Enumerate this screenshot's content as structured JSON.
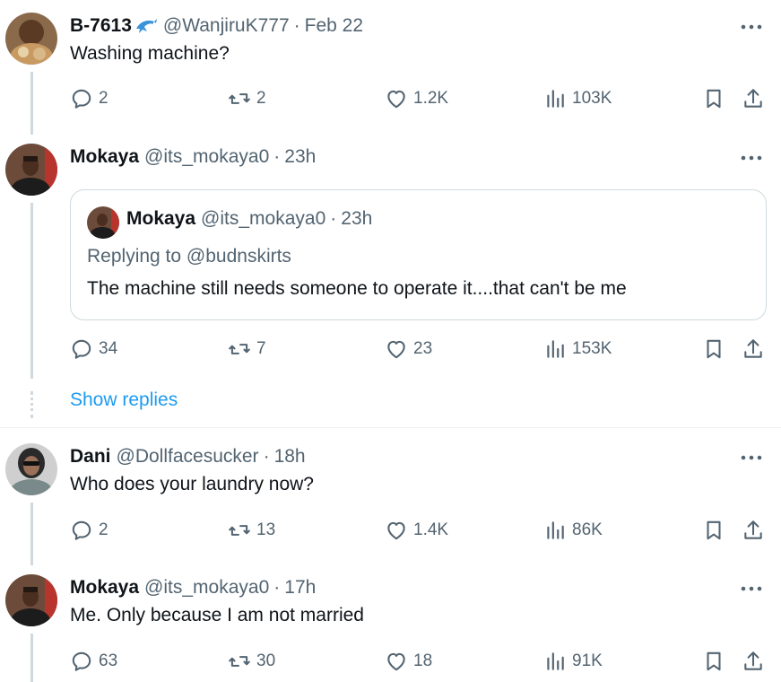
{
  "tweets": [
    {
      "name": "B-7613",
      "handle": "@WanjiruK777",
      "time": "Feb 22",
      "text": "Washing machine?",
      "replies": "2",
      "retweets": "2",
      "likes": "1.2K",
      "views": "103K",
      "emoji": "dolphin-emoji"
    },
    {
      "name": "Mokaya",
      "handle": "@its_mokaya0",
      "time": "23h",
      "quote": {
        "name": "Mokaya",
        "handle": "@its_mokaya0",
        "time": "23h",
        "replying_prefix": "Replying to",
        "replying_to": "@budnskirts",
        "text": "The machine still needs someone to operate it....that can't be me"
      },
      "replies": "34",
      "retweets": "7",
      "likes": "23",
      "views": "153K"
    },
    {
      "name": "Dani",
      "handle": "@Dollfacesucker",
      "time": "18h",
      "text": "Who does your laundry now?",
      "replies": "2",
      "retweets": "13",
      "likes": "1.4K",
      "views": "86K"
    },
    {
      "name": "Mokaya",
      "handle": "@its_mokaya0",
      "time": "17h",
      "text": "Me. Only because I am not married",
      "replies": "63",
      "retweets": "30",
      "likes": "18",
      "views": "91K"
    }
  ],
  "show_replies_label": "Show replies",
  "separator": "·",
  "colors": {
    "text": "#0f1419",
    "secondary": "#536471",
    "link": "#1d9bf0",
    "border": "#cfd9de"
  }
}
